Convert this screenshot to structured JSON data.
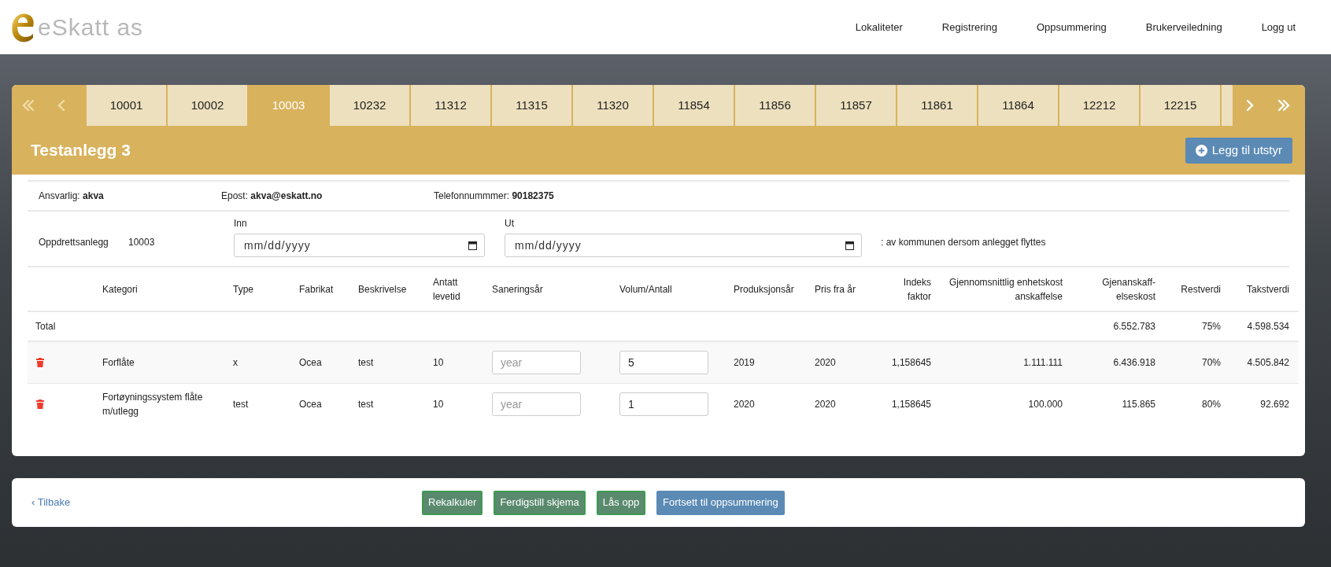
{
  "header": {
    "logo_text": "eSkatt as",
    "nav": [
      {
        "label": "Lokaliteter"
      },
      {
        "label": "Registrering"
      },
      {
        "label": "Oppsummering"
      },
      {
        "label": "Brukerveiledning"
      },
      {
        "label": "Logg ut"
      }
    ]
  },
  "tab_nav_left": [
    {
      "kind": "first",
      "disabled": true
    },
    {
      "kind": "previous",
      "disabled": true
    }
  ],
  "tabs": [
    {
      "label": "10001",
      "selected": false
    },
    {
      "label": "10002",
      "selected": false
    },
    {
      "label": "10003",
      "selected": true
    },
    {
      "label": "10232",
      "selected": false
    },
    {
      "label": "11312",
      "selected": false
    },
    {
      "label": "11315",
      "selected": false
    },
    {
      "label": "11320",
      "selected": false
    },
    {
      "label": "11854",
      "selected": false
    },
    {
      "label": "11856",
      "selected": false
    },
    {
      "label": "11857",
      "selected": false
    },
    {
      "label": "11861",
      "selected": false
    },
    {
      "label": "11864",
      "selected": false
    },
    {
      "label": "12212",
      "selected": false
    },
    {
      "label": "12215",
      "selected": false
    }
  ],
  "tab_nav_right": [
    {
      "kind": "next",
      "disabled": false
    },
    {
      "kind": "last",
      "disabled": false
    }
  ],
  "title": "Testanlegg 3",
  "add_button": "Legg til utstyr",
  "contact": [
    {
      "label": "Ansvarlig:",
      "value": "akva"
    },
    {
      "label": "Epost:",
      "value": "akva@eskatt.no"
    },
    {
      "label": "Telefonnummmer:",
      "value": "90182375"
    }
  ],
  "facility": {
    "label": "Oppdrettsanlegg",
    "number": "10003",
    "dates": [
      {
        "label": "Inn",
        "placeholder": "mm/dd/yyyy"
      },
      {
        "label": "Ut",
        "placeholder": "mm/dd/yyyy"
      }
    ],
    "note": ": av kommunen dersom anlegget flyttes"
  },
  "table": {
    "columns": [
      {},
      {
        "label": "Kategori"
      },
      {
        "label": "Type"
      },
      {
        "label": "Fabrikat"
      },
      {
        "label": "Beskrivelse"
      },
      {
        "label": "Antatt levetid"
      },
      {
        "label": "Saneringsår"
      },
      {
        "label": "Volum/Antall"
      },
      {
        "label": "Produksjonsår"
      },
      {
        "label": "Pris fra år"
      },
      {
        "label": "Indeks faktor"
      },
      {
        "label": "Gjennomsnittlig enhetskost anskaffelse"
      },
      {
        "label": "Gjenanskaff-elseskost"
      },
      {
        "label": "Restverdi"
      },
      {
        "label": "Takstverdi"
      }
    ],
    "total": {
      "label": "Total",
      "gjenanskaffelseskost": "6.552.783",
      "restverdi": "75%",
      "takstverdi": "4.598.534"
    },
    "rows": [
      {
        "cells": [
          {
            "kind": "delete"
          },
          {
            "kind": "text",
            "text": "Forflåte"
          },
          {
            "kind": "text",
            "text": "x"
          },
          {
            "kind": "text",
            "text": "Ocea"
          },
          {
            "kind": "text",
            "text": "test"
          },
          {
            "kind": "text",
            "text": "10"
          },
          {
            "kind": "input",
            "placeholder": "year"
          },
          {
            "kind": "input",
            "value": "5"
          },
          {
            "kind": "text",
            "text": "2019"
          },
          {
            "kind": "text",
            "text": "2020"
          },
          {
            "kind": "text",
            "text": "1,158645"
          },
          {
            "kind": "text",
            "text": "1.111.111"
          },
          {
            "kind": "text",
            "text": "6.436.918"
          },
          {
            "kind": "text",
            "text": "70%"
          },
          {
            "kind": "text",
            "text": "4.505.842"
          }
        ]
      },
      {
        "cells": [
          {
            "kind": "delete"
          },
          {
            "kind": "text",
            "text": "Fortøyningssystem flåte m/utlegg"
          },
          {
            "kind": "text",
            "text": "test"
          },
          {
            "kind": "text",
            "text": "Ocea"
          },
          {
            "kind": "text",
            "text": "test"
          },
          {
            "kind": "text",
            "text": "10"
          },
          {
            "kind": "input",
            "placeholder": "year"
          },
          {
            "kind": "input",
            "value": "1"
          },
          {
            "kind": "text",
            "text": "2020"
          },
          {
            "kind": "text",
            "text": "2020"
          },
          {
            "kind": "text",
            "text": "1,158645"
          },
          {
            "kind": "text",
            "text": "100.000"
          },
          {
            "kind": "text",
            "text": "115.865"
          },
          {
            "kind": "text",
            "text": "80%"
          },
          {
            "kind": "text",
            "text": "92.692"
          }
        ]
      }
    ]
  },
  "footer": {
    "back_link": "‹ Tilbake",
    "buttons": [
      {
        "label": "Rekalkuler",
        "kind": "success"
      },
      {
        "label": "Ferdigstill skjema",
        "kind": "success"
      },
      {
        "label": "Lås opp",
        "kind": "success"
      },
      {
        "label": "Fortsett til oppsummering",
        "kind": "primary"
      }
    ]
  }
}
